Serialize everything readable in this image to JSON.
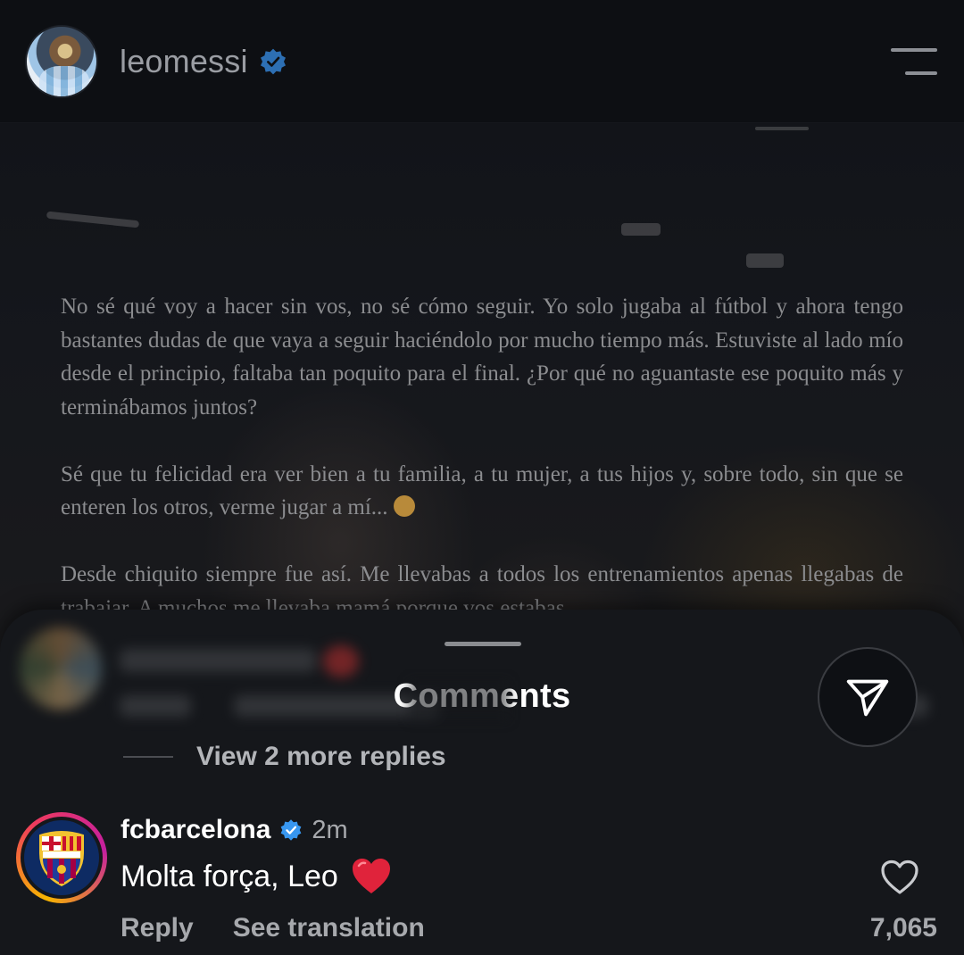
{
  "header": {
    "username": "leomessi",
    "verified_icon": "verified-badge-icon",
    "menu_icon": "menu-icon"
  },
  "post": {
    "paragraphs": [
      "No sé qué voy a hacer sin vos, no sé cómo seguir. Yo solo jugaba al fútbol y ahora tengo bastantes dudas de que vaya a seguir haciéndolo por mucho tiempo más. Estuviste al lado mío desde el principio, faltaba tan poquito para el final. ¿Por qué no aguantaste ese poquito más y terminábamos juntos?",
      "Sé que tu felicidad era ver bien a tu familia, a tu mujer, a tus hijos y, sobre todo, sin que se enteren los otros, verme jugar a mí...",
      "Desde chiquito siempre fue así. Me llevabas a todos los entrenamientos apenas llegabas de trabajar. A muchos me llevaba mamá porque vos estabas"
    ]
  },
  "comments_sheet": {
    "title": "Comments",
    "view_more_replies": "View 2 more replies",
    "comment": {
      "username": "fcbarcelona",
      "time": "2m",
      "text": "Molta força, Leo",
      "reply_label": "Reply",
      "translate_label": "See translation",
      "like_count": "7,065"
    }
  },
  "colors": {
    "background": "#0b0d11",
    "sheet": "#15171b",
    "verified": "#3897f0",
    "heart_emoji": "#e0233b"
  }
}
